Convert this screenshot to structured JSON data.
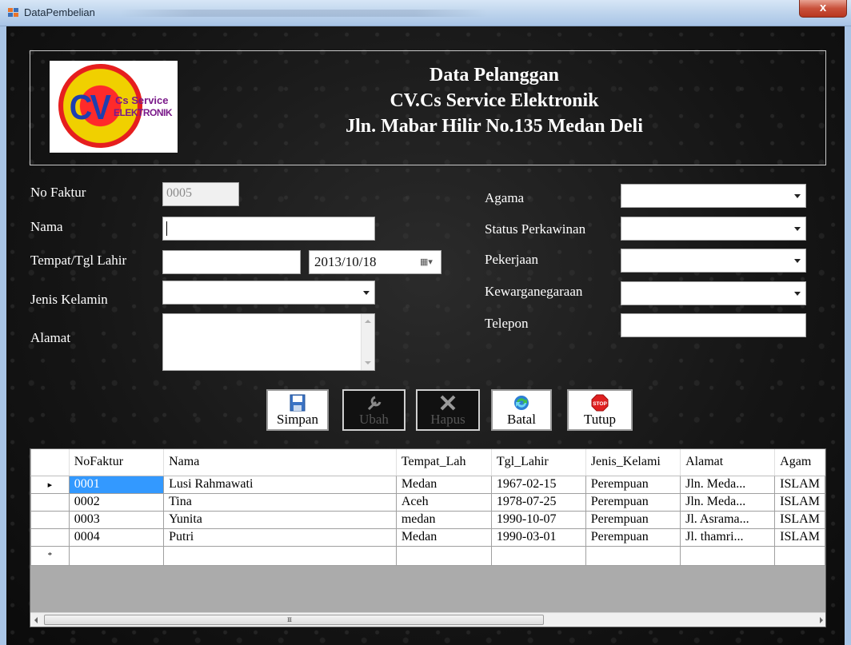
{
  "window": {
    "title": "DataPembelian",
    "close_label": "x"
  },
  "header": {
    "logo": {
      "mark": "CV",
      "line1": "Cs Service",
      "line2": "ELEKTRONIK"
    },
    "title": "Data Pelanggan",
    "company": "CV.Cs Service Elektronik",
    "address": "Jln. Mabar Hilir No.135 Medan Deli"
  },
  "form": {
    "no_faktur": {
      "label": "No Faktur",
      "value": "0005"
    },
    "nama": {
      "label": "Nama",
      "value": ""
    },
    "tempat_tgl_lahir": {
      "label": "Tempat/Tgl Lahir",
      "tempat": "",
      "tanggal": "2013/10/18"
    },
    "jenis_kelamin": {
      "label": "Jenis Kelamin",
      "value": ""
    },
    "alamat": {
      "label": "Alamat",
      "value": ""
    },
    "agama": {
      "label": "Agama",
      "value": ""
    },
    "status_perkawinan": {
      "label": "Status Perkawinan",
      "value": ""
    },
    "pekerjaan": {
      "label": "Pekerjaan",
      "value": ""
    },
    "kewarganegaraan": {
      "label": "Kewarganegaraan",
      "value": ""
    },
    "telepon": {
      "label": "Telepon",
      "value": ""
    }
  },
  "buttons": {
    "simpan": {
      "label": "Simpan",
      "icon": "floppy-disk-icon",
      "enabled": true
    },
    "ubah": {
      "label": "Ubah",
      "icon": "wrench-icon",
      "enabled": false
    },
    "hapus": {
      "label": "Hapus",
      "icon": "x-delete-icon",
      "enabled": false
    },
    "batal": {
      "label": "Batal",
      "icon": "refresh-icon",
      "enabled": true
    },
    "tutup": {
      "label": "Tutup",
      "icon": "stop-sign-icon",
      "enabled": true,
      "icon_text": "STOP"
    }
  },
  "grid": {
    "columns": [
      "NoFaktur",
      "Nama",
      "Tempat_Lah",
      "Tgl_Lahir",
      "Jenis_Kelami",
      "Alamat",
      "Agam"
    ],
    "rows": [
      [
        "0001",
        "Lusi Rahmawati",
        "Medan",
        "1967-02-15",
        "Perempuan",
        "Jln. Meda...",
        "ISLAM"
      ],
      [
        "0002",
        "Tina",
        "Aceh",
        "1978-07-25",
        "Perempuan",
        "Jln. Meda...",
        "ISLAM"
      ],
      [
        "0003",
        "Yunita",
        "medan",
        "1990-10-07",
        "Perempuan",
        "Jl. Asrama...",
        "ISLAM"
      ],
      [
        "0004",
        "Putri",
        "Medan",
        "1990-03-01",
        "Perempuan",
        "Jl. thamri...",
        "ISLAM"
      ]
    ],
    "selected_row": 0,
    "current_row_marker": "▸",
    "new_row_marker": "*",
    "scrollbar_grip": "III"
  },
  "colors": {
    "background": "#151515",
    "selection": "#3399ff",
    "close_button": "#c9513b"
  }
}
